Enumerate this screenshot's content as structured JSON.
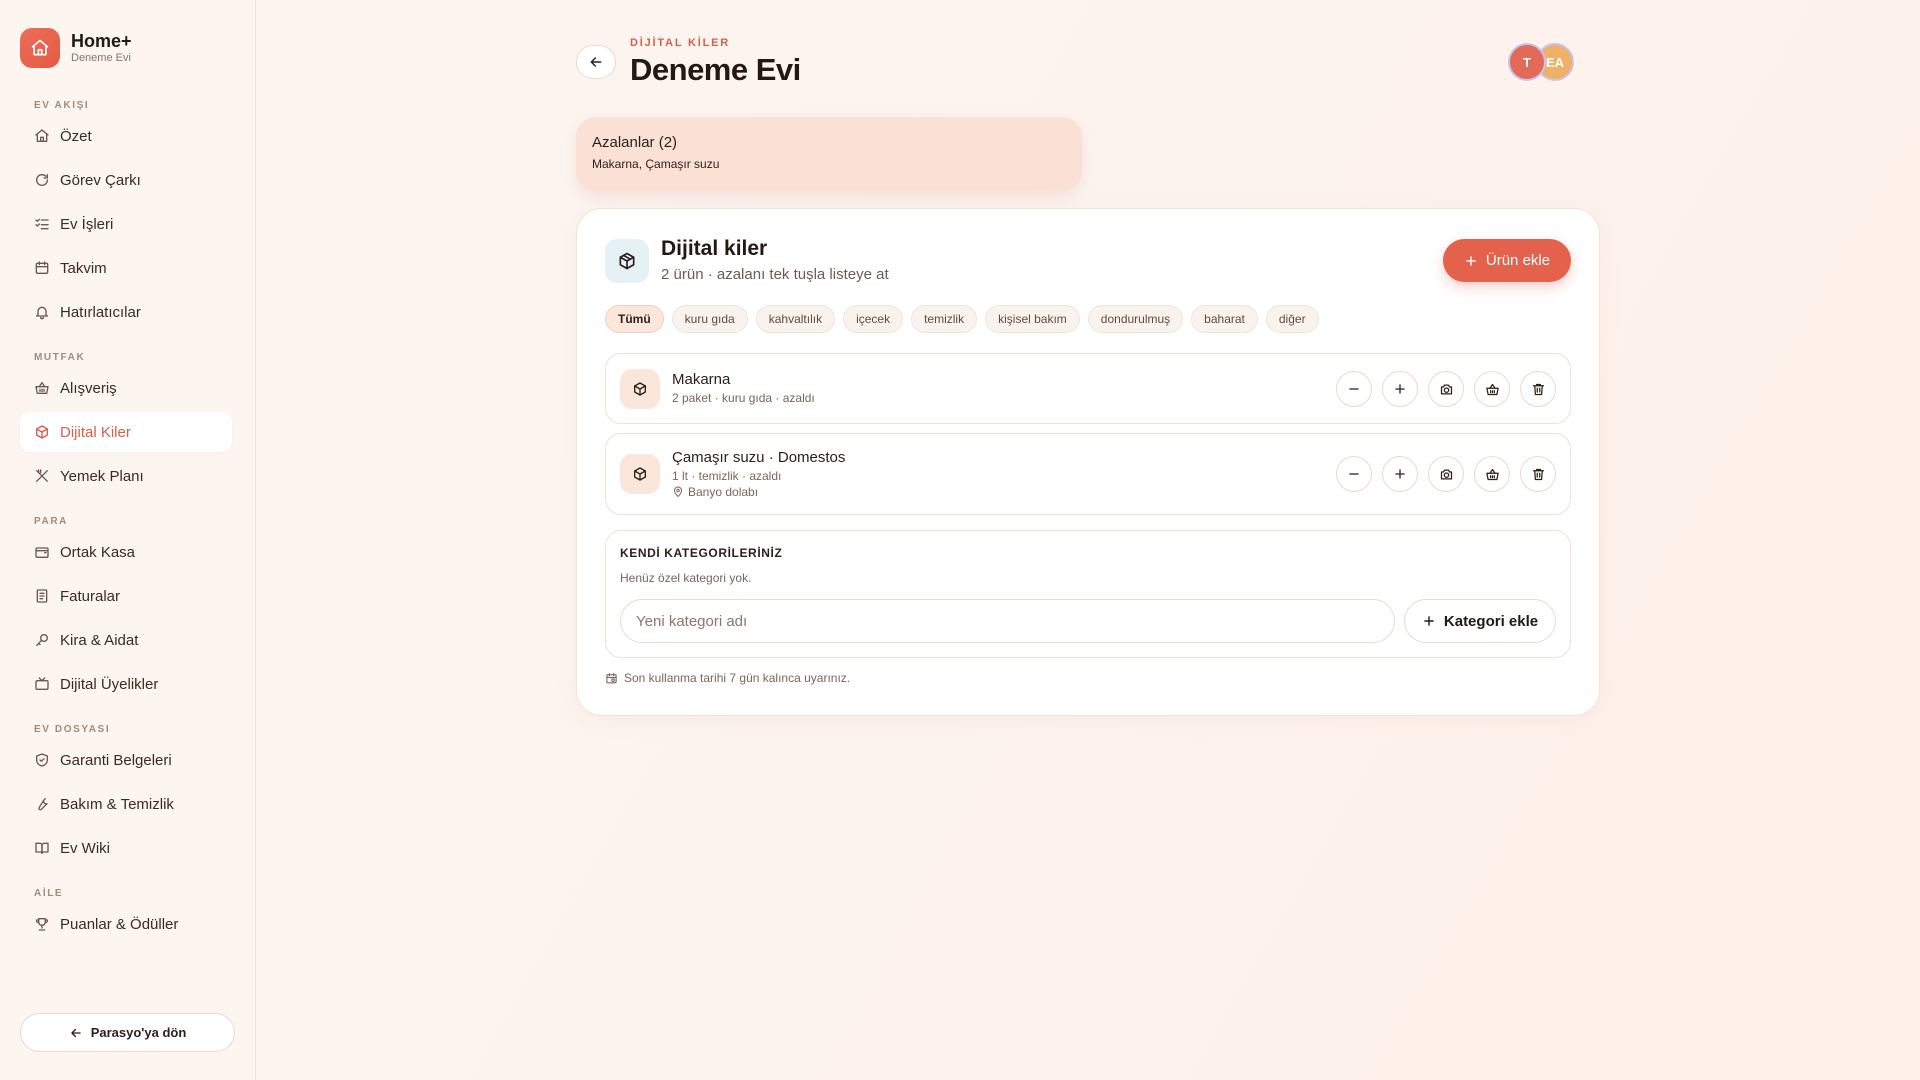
{
  "app": {
    "name": "Home+",
    "subtitle": "Deneme Evi"
  },
  "sidebar": {
    "sections": [
      {
        "title": "EV AKIŞI",
        "items": [
          {
            "label": "Özet",
            "icon": "home-icon"
          },
          {
            "label": "Görev Çarkı",
            "icon": "refresh-icon"
          },
          {
            "label": "Ev İşleri",
            "icon": "checklist-icon"
          },
          {
            "label": "Takvim",
            "icon": "calendar-icon"
          },
          {
            "label": "Hatırlatıcılar",
            "icon": "bell-icon"
          }
        ]
      },
      {
        "title": "MUTFAK",
        "items": [
          {
            "label": "Alışveriş",
            "icon": "basket-icon"
          },
          {
            "label": "Dijital Kiler",
            "icon": "package-icon",
            "active": true
          },
          {
            "label": "Yemek Planı",
            "icon": "utensils-icon"
          }
        ]
      },
      {
        "title": "PARA",
        "items": [
          {
            "label": "Ortak Kasa",
            "icon": "wallet-icon"
          },
          {
            "label": "Faturalar",
            "icon": "receipt-icon"
          },
          {
            "label": "Kira & Aidat",
            "icon": "key-icon"
          },
          {
            "label": "Dijital Üyelikler",
            "icon": "tv-icon"
          }
        ]
      },
      {
        "title": "EV DOSYASI",
        "items": [
          {
            "label": "Garanti Belgeleri",
            "icon": "shield-icon"
          },
          {
            "label": "Bakım & Temizlik",
            "icon": "wrench-icon"
          },
          {
            "label": "Ev Wiki",
            "icon": "book-icon"
          }
        ]
      },
      {
        "title": "AİLE",
        "items": [
          {
            "label": "Puanlar & Ödüller",
            "icon": "trophy-icon"
          }
        ]
      }
    ],
    "back_label": "Parasyo'ya dön"
  },
  "header": {
    "eyebrow": "DİJİTAL KİLER",
    "title": "Deneme Evi",
    "avatars": [
      "T",
      "EA"
    ]
  },
  "low_stock": {
    "title": "Azalanlar (2)",
    "items": "Makarna, Çamaşır suzu"
  },
  "panel": {
    "title": "Dijital kiler",
    "subtitle": "2 ürün · azalanı tek tuşla listeye at",
    "add_label": "Ürün ekle",
    "filters": [
      "Tümü",
      "kuru gıda",
      "kahvaltılık",
      "içecek",
      "temizlik",
      "kişisel bakım",
      "dondurulmuş",
      "baharat",
      "diğer"
    ],
    "active_filter": "Tümü",
    "items": [
      {
        "name": "Makarna",
        "meta": "2 paket · kuru gıda · azaldı"
      },
      {
        "name": "Çamaşır suzu · Domestos",
        "meta": "1 lt · temizlik · azaldı",
        "location": "Banyo dolabı"
      }
    ],
    "categories": {
      "title": "KENDİ KATEGORİLERİNİZ",
      "empty": "Henüz özel kategori yok.",
      "placeholder": "Yeni kategori adı",
      "add_label": "Kategori ekle"
    },
    "note": "Son kullanma tarihi 7 gün kalınca uyarınız."
  },
  "colors": {
    "accent": "#e4614b",
    "active_text": "#d4604b",
    "low_bg": "#fae0d5"
  }
}
